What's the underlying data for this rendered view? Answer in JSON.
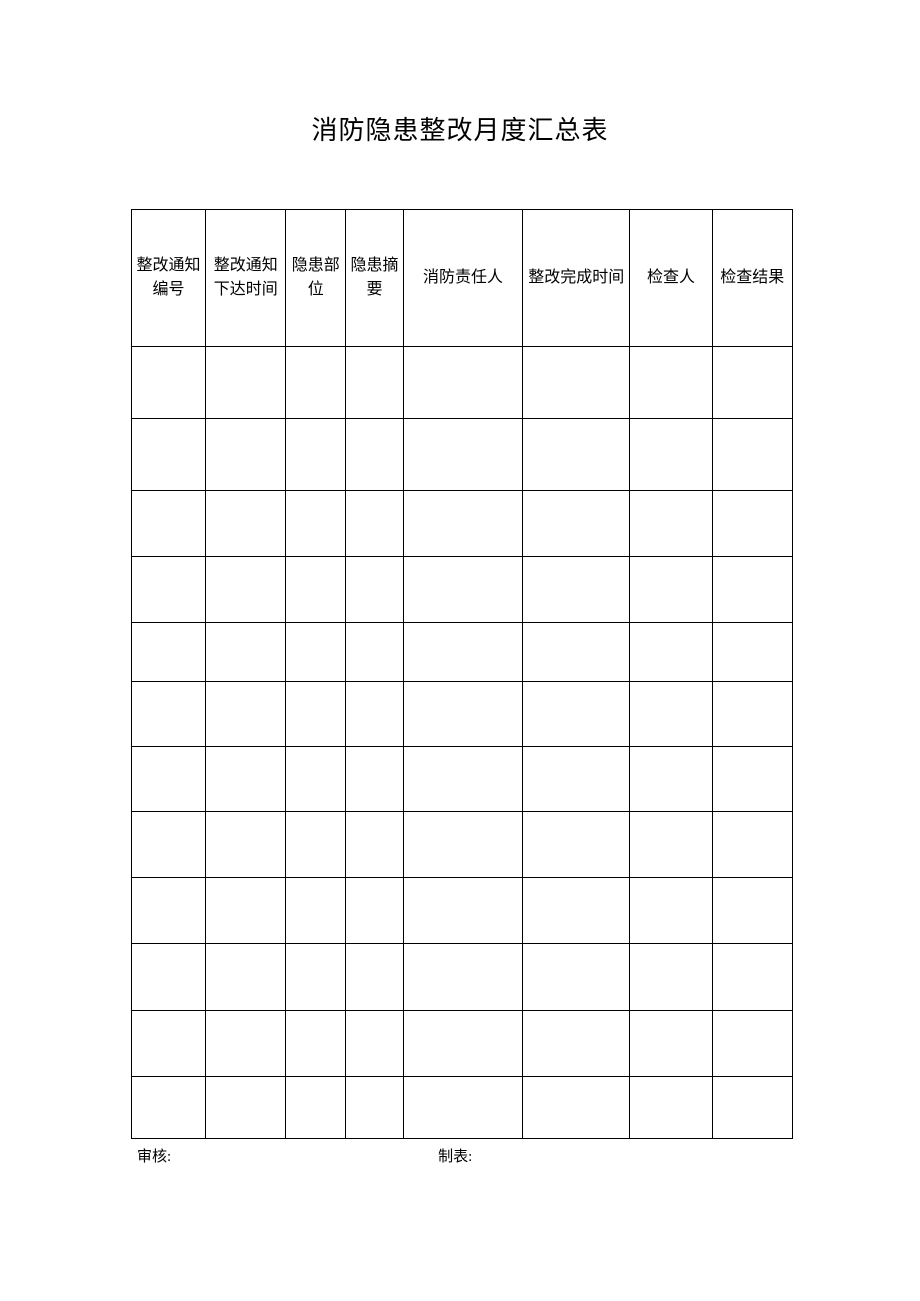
{
  "title": "消防隐患整改月度汇总表",
  "columns": [
    "整改通知编号",
    "整改通知下达时间",
    "隐患部位",
    "隐患摘要",
    "消防责任人",
    "整改完成时间",
    "检查人",
    "检查结果"
  ],
  "rows": [
    [
      "",
      "",
      "",
      "",
      "",
      "",
      "",
      ""
    ],
    [
      "",
      "",
      "",
      "",
      "",
      "",
      "",
      ""
    ],
    [
      "",
      "",
      "",
      "",
      "",
      "",
      "",
      ""
    ],
    [
      "",
      "",
      "",
      "",
      "",
      "",
      "",
      ""
    ],
    [
      "",
      "",
      "",
      "",
      "",
      "",
      "",
      ""
    ],
    [
      "",
      "",
      "",
      "",
      "",
      "",
      "",
      ""
    ],
    [
      "",
      "",
      "",
      "",
      "",
      "",
      "",
      ""
    ],
    [
      "",
      "",
      "",
      "",
      "",
      "",
      "",
      ""
    ],
    [
      "",
      "",
      "",
      "",
      "",
      "",
      "",
      ""
    ],
    [
      "",
      "",
      "",
      "",
      "",
      "",
      "",
      ""
    ],
    [
      "",
      "",
      "",
      "",
      "",
      "",
      "",
      ""
    ],
    [
      "",
      "",
      "",
      "",
      "",
      "",
      "",
      ""
    ]
  ],
  "footer": {
    "review_label": "审核:",
    "preparer_label": "制表:"
  }
}
